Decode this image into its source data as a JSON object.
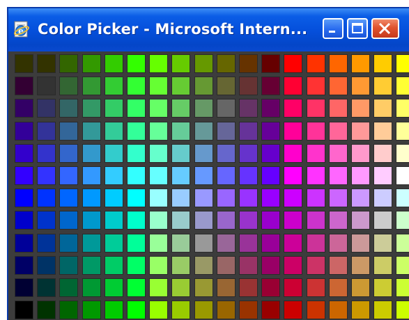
{
  "window": {
    "title": "Color Picker - Microsoft Intern...",
    "icon": "internet-explorer-icon",
    "buttons": [
      "minimize",
      "maximize",
      "close"
    ]
  },
  "colors": {
    "titlebar": "#0550dc",
    "background": "#3c3c3c"
  },
  "palette": {
    "rows": [
      [
        "#333300",
        "#333300",
        "#336600",
        "#339900",
        "#33cc00",
        "#33ff00",
        "#66ff00",
        "#66cc00",
        "#669900",
        "#666600",
        "#663300",
        "#660000",
        "#ff0000",
        "#ff3300",
        "#ff6600",
        "#ff9900",
        "#ffcc00",
        "#ffff00"
      ],
      [
        "#330033",
        "#333333",
        "#336633",
        "#339933",
        "#33cc33",
        "#33ff33",
        "#66ff33",
        "#66cc33",
        "#669933",
        "#666633",
        "#663333",
        "#660033",
        "#ff0033",
        "#ff3333",
        "#ff6633",
        "#ff9933",
        "#ffcc33",
        "#ffff33"
      ],
      [
        "#330066",
        "#333366",
        "#336666",
        "#339966",
        "#33cc66",
        "#33ff66",
        "#66ff66",
        "#66cc66",
        "#669966",
        "#666666",
        "#663366",
        "#660066",
        "#ff0066",
        "#ff3366",
        "#ff6666",
        "#ff9966",
        "#ffcc66",
        "#ffff66"
      ],
      [
        "#330099",
        "#333399",
        "#336699",
        "#339999",
        "#33cc99",
        "#33ff99",
        "#66ff99",
        "#66cc99",
        "#669999",
        "#666699",
        "#663399",
        "#660099",
        "#ff0099",
        "#ff3399",
        "#ff6699",
        "#ff9999",
        "#ffcc99",
        "#ffff99"
      ],
      [
        "#3300cc",
        "#3333cc",
        "#3366cc",
        "#3399cc",
        "#33cccc",
        "#33ffcc",
        "#66ffcc",
        "#66cccc",
        "#6699cc",
        "#6666cc",
        "#6633cc",
        "#6600cc",
        "#ff00cc",
        "#ff33cc",
        "#ff66cc",
        "#ff99cc",
        "#ffcccc",
        "#ffffcc"
      ],
      [
        "#3300ff",
        "#3333ff",
        "#3366ff",
        "#3399ff",
        "#33ccff",
        "#33ffff",
        "#66ffff",
        "#66ccff",
        "#6699ff",
        "#6666ff",
        "#6633ff",
        "#6600ff",
        "#ff00ff",
        "#ff33ff",
        "#ff66ff",
        "#ff99ff",
        "#ffccff",
        "#ffffff"
      ],
      [
        "#0000ff",
        "#0033ff",
        "#0066ff",
        "#0099ff",
        "#00ccff",
        "#00ffff",
        "#99ffff",
        "#99ccff",
        "#9999ff",
        "#9966ff",
        "#9933ff",
        "#9900ff",
        "#cc00ff",
        "#cc33ff",
        "#cc66ff",
        "#cc99ff",
        "#ccccff",
        "#ccffff"
      ],
      [
        "#0000cc",
        "#0033cc",
        "#0066cc",
        "#0099cc",
        "#00cccc",
        "#00ffcc",
        "#99ffcc",
        "#99cccc",
        "#9999cc",
        "#9966cc",
        "#9933cc",
        "#9900cc",
        "#cc00cc",
        "#cc33cc",
        "#cc66cc",
        "#cc99cc",
        "#cccccc",
        "#ccffcc"
      ],
      [
        "#000099",
        "#003399",
        "#006699",
        "#009999",
        "#00cc99",
        "#00ff99",
        "#99ff99",
        "#99cc99",
        "#999999",
        "#996699",
        "#993399",
        "#990099",
        "#cc0099",
        "#cc3399",
        "#cc6699",
        "#cc9999",
        "#cccc99",
        "#ccff99"
      ],
      [
        "#000066",
        "#003366",
        "#006666",
        "#009966",
        "#00cc66",
        "#00ff66",
        "#99ff66",
        "#99cc66",
        "#999966",
        "#996666",
        "#993366",
        "#990066",
        "#cc0066",
        "#cc3366",
        "#cc6666",
        "#cc9966",
        "#cccc66",
        "#ccff66"
      ],
      [
        "#000033",
        "#003333",
        "#006633",
        "#009933",
        "#00cc33",
        "#00ff33",
        "#99ff33",
        "#99cc33",
        "#999933",
        "#996633",
        "#993333",
        "#990033",
        "#cc0033",
        "#cc3333",
        "#cc6633",
        "#cc9933",
        "#cccc33",
        "#ccff33"
      ],
      [
        "#000000",
        "#003300",
        "#006600",
        "#009900",
        "#00cc00",
        "#00ff00",
        "#99ff00",
        "#99cc00",
        "#999900",
        "#996600",
        "#993300",
        "#990000",
        "#cc0000",
        "#cc3300",
        "#cc6600",
        "#cc9900",
        "#cccc00",
        "#ccff00"
      ]
    ]
  }
}
